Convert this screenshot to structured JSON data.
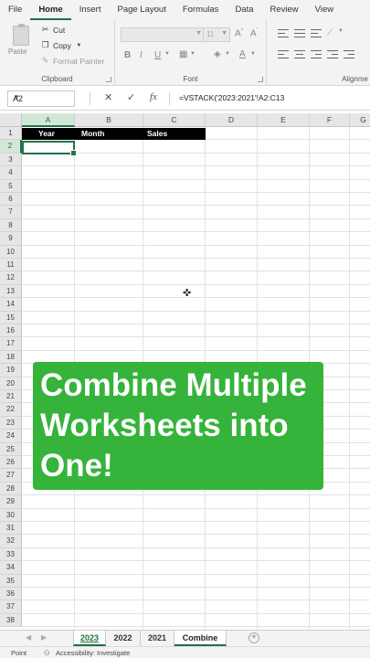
{
  "ribbon": {
    "tabs": [
      "File",
      "Home",
      "Insert",
      "Page Layout",
      "Formulas",
      "Data",
      "Review",
      "View"
    ],
    "active_tab": "Home",
    "clipboard": {
      "paste_label": "Paste",
      "cut_label": "Cut",
      "copy_label": "Copy",
      "format_painter_label": "Format Painter",
      "group_label": "Clipboard"
    },
    "font": {
      "font_name": "",
      "font_size": "11",
      "group_label": "Font",
      "bold": "B",
      "italic": "I",
      "underline": "U"
    },
    "alignment": {
      "group_label": "Alignme"
    }
  },
  "formula_bar": {
    "name_box": "A2",
    "formula": "=VSTACK('2023:2021'!A2:C13"
  },
  "grid": {
    "columns": [
      "A",
      "B",
      "C",
      "D",
      "E",
      "F",
      "G"
    ],
    "rows": [
      "1",
      "2",
      "3",
      "4",
      "5",
      "6",
      "7",
      "8",
      "9",
      "10",
      "11",
      "12",
      "13",
      "14",
      "15",
      "16",
      "17",
      "18",
      "19",
      "20",
      "21",
      "22",
      "23",
      "24",
      "25",
      "26",
      "27",
      "28",
      "29",
      "30",
      "31",
      "32",
      "33",
      "34",
      "35",
      "36",
      "37",
      "38"
    ],
    "selected_column": "A",
    "selected_row": "2",
    "header_cells": [
      "Year",
      "Month",
      "Sales"
    ]
  },
  "banner": {
    "line1": "Combine Multiple",
    "line2": "Worksheets into",
    "line3": "One!"
  },
  "sheets": {
    "tabs": [
      "2023",
      "2022",
      "2021",
      "Combine"
    ],
    "active": "Combine"
  },
  "status": {
    "mode": "Point",
    "accessibility": "Accessibility: Investigate"
  }
}
